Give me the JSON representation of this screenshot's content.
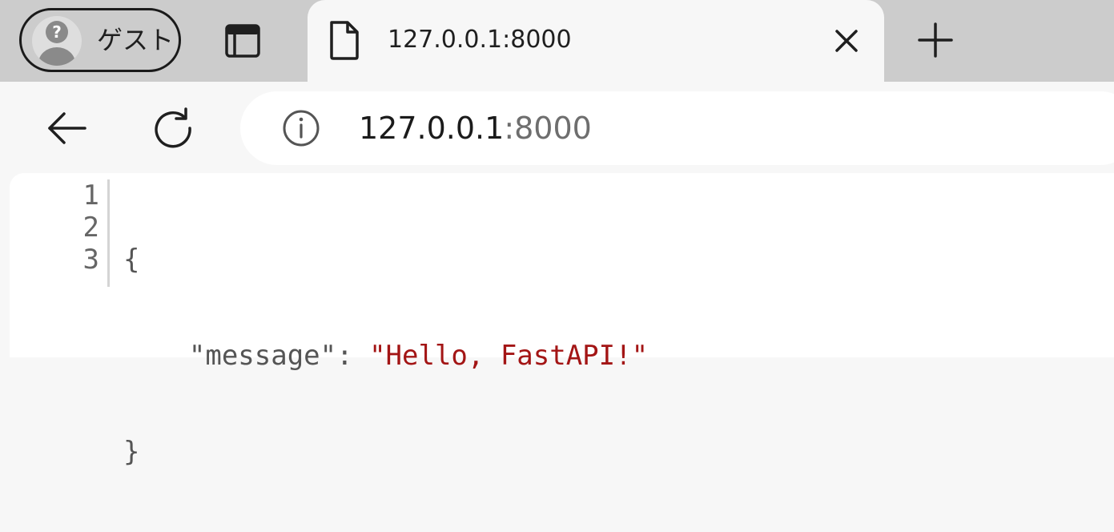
{
  "profile": {
    "name": "ゲスト"
  },
  "tab": {
    "title": "127.0.0.1:8000"
  },
  "address_bar": {
    "host": "127.0.0.1",
    "port": ":8000"
  },
  "json_viewer": {
    "line_numbers": [
      "1",
      "2",
      "3"
    ],
    "open_brace": "{",
    "indent": "    ",
    "key": "\"message\"",
    "separator": ": ",
    "value": "\"Hello, FastAPI!\"",
    "close_brace": "}"
  },
  "colors": {
    "tabstrip_bg": "#cccccc",
    "toolbar_bg": "#f7f7f7",
    "json_string_value": "#a31515",
    "json_key": "#555555"
  }
}
